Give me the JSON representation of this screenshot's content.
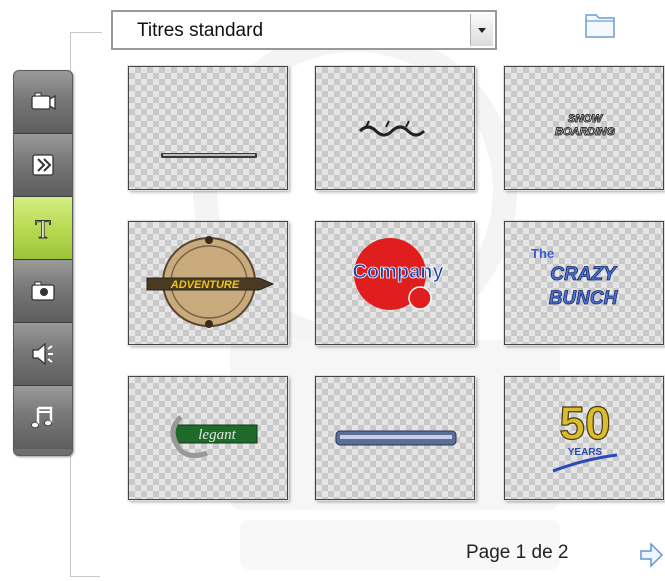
{
  "title_category": {
    "selected": "Titres standard"
  },
  "toolbar": {
    "tools": [
      {
        "name": "video",
        "icon": "camcorder-icon",
        "active": false
      },
      {
        "name": "transitions",
        "icon": "transition-icon",
        "active": false
      },
      {
        "name": "titles",
        "icon": "title-t-icon",
        "active": true
      },
      {
        "name": "photos",
        "icon": "camera-icon",
        "active": false
      },
      {
        "name": "sound-effects",
        "icon": "speaker-icon",
        "active": false
      },
      {
        "name": "music",
        "icon": "music-note-icon",
        "active": false
      }
    ]
  },
  "thumbnails": [
    {
      "style": "minimal-caption"
    },
    {
      "style": "script-caption"
    },
    {
      "style": "Snow Boarding",
      "text": "SNOW BOARDING"
    },
    {
      "style": "adventure",
      "text": "ADVENTURE"
    },
    {
      "style": "company",
      "text": "Company"
    },
    {
      "style": "crazy-bunch",
      "text": [
        "The",
        "CRAZY",
        "BUNCH"
      ]
    },
    {
      "style": "elegant",
      "text": "Elegant"
    },
    {
      "style": "metal-bar"
    },
    {
      "style": "50-years",
      "text": [
        "50",
        "YEARS"
      ]
    }
  ],
  "pagination": {
    "label": "Page 1 de 2"
  },
  "colors": {
    "active_tool": "#b8da52",
    "tool": "#787878",
    "checker_light": "#e5e5e5",
    "checker_dark": "#c9c9c9"
  }
}
